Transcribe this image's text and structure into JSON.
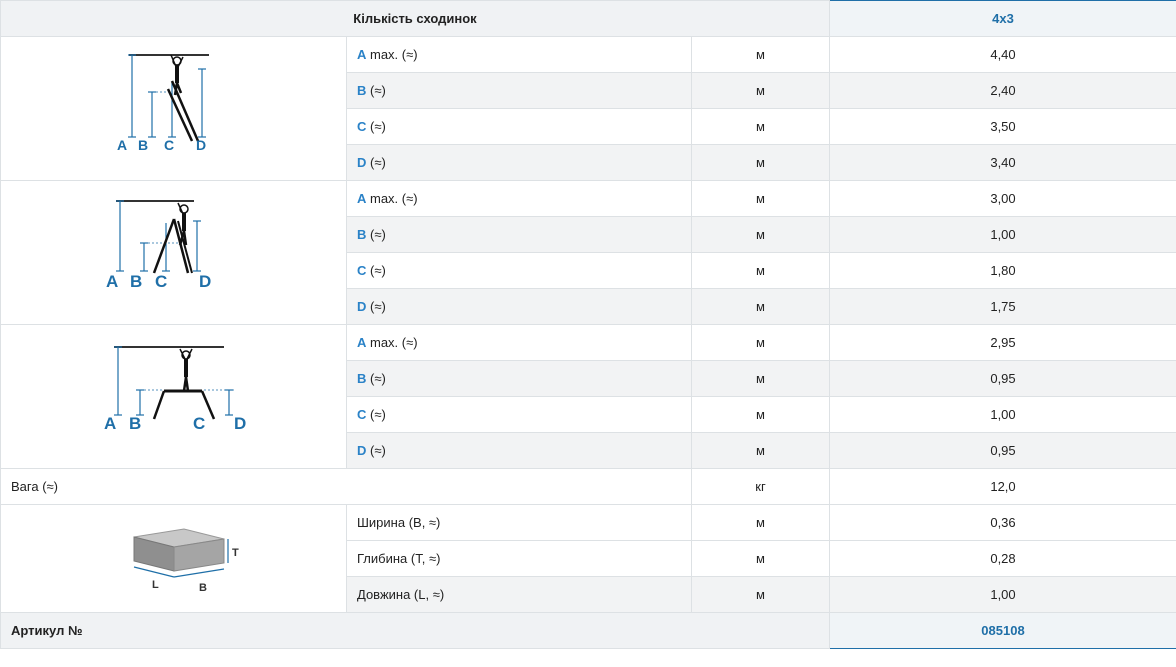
{
  "header": {
    "label": "Кількість сходинок",
    "value": "4x3"
  },
  "groups": [
    {
      "rows": [
        {
          "letter": "A",
          "suffix": " max. (≈)",
          "unit": "м",
          "value": "4,40"
        },
        {
          "letter": "B",
          "suffix": " (≈)",
          "unit": "м",
          "value": "2,40"
        },
        {
          "letter": "C",
          "suffix": " (≈)",
          "unit": "м",
          "value": "3,50"
        },
        {
          "letter": "D",
          "suffix": " (≈)",
          "unit": "м",
          "value": "3,40"
        }
      ]
    },
    {
      "rows": [
        {
          "letter": "A",
          "suffix": " max. (≈)",
          "unit": "м",
          "value": "3,00"
        },
        {
          "letter": "B",
          "suffix": " (≈)",
          "unit": "м",
          "value": "1,00"
        },
        {
          "letter": "C",
          "suffix": " (≈)",
          "unit": "м",
          "value": "1,80"
        },
        {
          "letter": "D",
          "suffix": " (≈)",
          "unit": "м",
          "value": "1,75"
        }
      ]
    },
    {
      "rows": [
        {
          "letter": "A",
          "suffix": " max. (≈)",
          "unit": "м",
          "value": "2,95"
        },
        {
          "letter": "B",
          "suffix": " (≈)",
          "unit": "м",
          "value": "0,95"
        },
        {
          "letter": "C",
          "suffix": " (≈)",
          "unit": "м",
          "value": "1,00"
        },
        {
          "letter": "D",
          "suffix": " (≈)",
          "unit": "м",
          "value": "0,95"
        }
      ]
    }
  ],
  "diagram_labels": {
    "a": "A",
    "b": "B",
    "c": "C",
    "d": "D",
    "t": "T",
    "l": "L",
    "bw": "B"
  },
  "weight": {
    "label": "Вага (≈)",
    "unit": "кг",
    "value": "12,0"
  },
  "package": [
    {
      "label": "Ширина (B, ≈)",
      "unit": "м",
      "value": "0,36"
    },
    {
      "label": "Глибина (T, ≈)",
      "unit": "м",
      "value": "0,28"
    },
    {
      "label": "Довжина (L, ≈)",
      "unit": "м",
      "value": "1,00"
    }
  ],
  "article": {
    "label": "Артикул №",
    "value": "085108"
  },
  "colors": {
    "accent": "#1f6fa8",
    "letter": "#2a82c7",
    "border": "#dde1e4",
    "stripe": "#f2f3f4"
  }
}
